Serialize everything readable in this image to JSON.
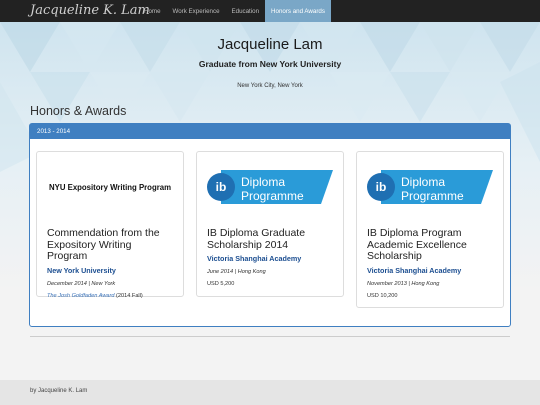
{
  "navbar": {
    "brand": "Jacqueline K. Lam",
    "items": [
      {
        "label": "Home",
        "active": false
      },
      {
        "label": "Work Experience",
        "active": false
      },
      {
        "label": "Education",
        "active": false
      },
      {
        "label": "Honors and Awards",
        "active": true
      }
    ]
  },
  "header": {
    "name": "Jacqueline Lam",
    "subtitle": "Graduate from New York University",
    "location": "New York City, New York"
  },
  "section": {
    "title": "Honors & Awards",
    "panel_heading": "2013 - 2014"
  },
  "cards": [
    {
      "logo_text": "NYU Expository Writing Program",
      "title": "Commendation from the Expository Writing Program",
      "institution": "New York University",
      "date": "December 2014",
      "location": "New York",
      "link_text": "The Josh Goldfaden Award",
      "link_suffix": "(2014 Fall)",
      "amount": ""
    },
    {
      "logo_text": "Diploma Programme",
      "logo_mark": "ib",
      "title": "IB Diploma Graduate Scholarship 2014",
      "institution": "Victoria Shanghai Academy",
      "date": "June 2014",
      "location": "Hong Kong",
      "amount": "USD 5,200"
    },
    {
      "logo_text": "Diploma Programme",
      "logo_mark": "ib",
      "title": "IB Diploma Program Academic Excellence Scholarship",
      "institution": "Victoria Shanghai Academy",
      "date": "November 2013",
      "location": "Hong Kong",
      "amount": "USD 10,200"
    }
  ],
  "footer": {
    "text": "by Jacqueline K. Lam"
  },
  "colors": {
    "navbar_bg": "#222222",
    "nav_active_bg": "#7aa7c7",
    "panel_accent": "#3f7fc1",
    "institution_text": "#1d4f91",
    "ib_blue": "#2a9bd8"
  }
}
